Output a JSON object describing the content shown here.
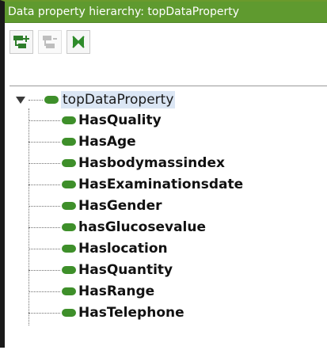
{
  "panel": {
    "title": "Data property hierarchy: topDataProperty"
  },
  "toolbar": {
    "buttons": [
      {
        "icon": "add-subproperty-icon",
        "enabled": true
      },
      {
        "icon": "add-sibling-property-icon",
        "enabled": false
      },
      {
        "icon": "delete-property-icon",
        "enabled": true
      }
    ]
  },
  "tree": {
    "root": {
      "label": "topDataProperty",
      "expanded": true,
      "selected": true
    },
    "children": [
      {
        "label": "HasQuality"
      },
      {
        "label": "HasAge"
      },
      {
        "label": "Hasbodymassindex"
      },
      {
        "label": "HasExaminationsdate"
      },
      {
        "label": "HasGender"
      },
      {
        "label": "hasGlucosevalue"
      },
      {
        "label": "Haslocation"
      },
      {
        "label": "HasQuantity"
      },
      {
        "label": "HasRange"
      },
      {
        "label": "HasTelephone"
      }
    ]
  },
  "colors": {
    "title_bar": "#5f9a2f",
    "property_icon": "#3e8f2a",
    "selection": "#dbe6f4"
  }
}
